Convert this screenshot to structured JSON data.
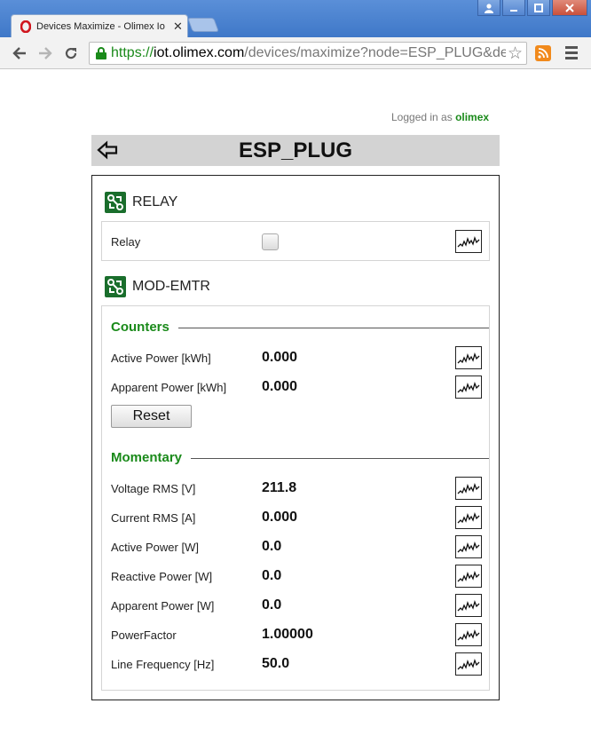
{
  "browser": {
    "tab_title": "Devices Maximize - Olimex Io",
    "url_scheme": "https://",
    "url_host": "iot.olimex.com",
    "url_path": "/devices/maximize?node=ESP_PLUG&de"
  },
  "session": {
    "logged_prefix": "Logged in as ",
    "username": "olimex"
  },
  "device": {
    "name": "ESP_PLUG"
  },
  "relay_module": {
    "name": "RELAY",
    "relay_label": "Relay"
  },
  "emtr_module": {
    "name": "MOD-EMTR",
    "counters_title": "Counters",
    "counters": [
      {
        "label": "Active Power [kWh]",
        "value": "0.000"
      },
      {
        "label": "Apparent Power [kWh]",
        "value": "0.000"
      }
    ],
    "reset_label": "Reset",
    "momentary_title": "Momentary",
    "momentary": [
      {
        "label": "Voltage RMS [V]",
        "value": "211.8"
      },
      {
        "label": "Current RMS [A]",
        "value": "0.000"
      },
      {
        "label": "Active Power [W]",
        "value": "0.0"
      },
      {
        "label": "Reactive Power [W]",
        "value": "0.0"
      },
      {
        "label": "Apparent Power [W]",
        "value": "0.0"
      },
      {
        "label": "PowerFactor",
        "value": "1.00000"
      },
      {
        "label": "Line Frequency [Hz]",
        "value": "50.0"
      }
    ]
  },
  "colors": {
    "accent_green": "#1a8a1a",
    "module_icon_bg": "#1a6e2c",
    "header_bg": "#d3d3d3"
  }
}
